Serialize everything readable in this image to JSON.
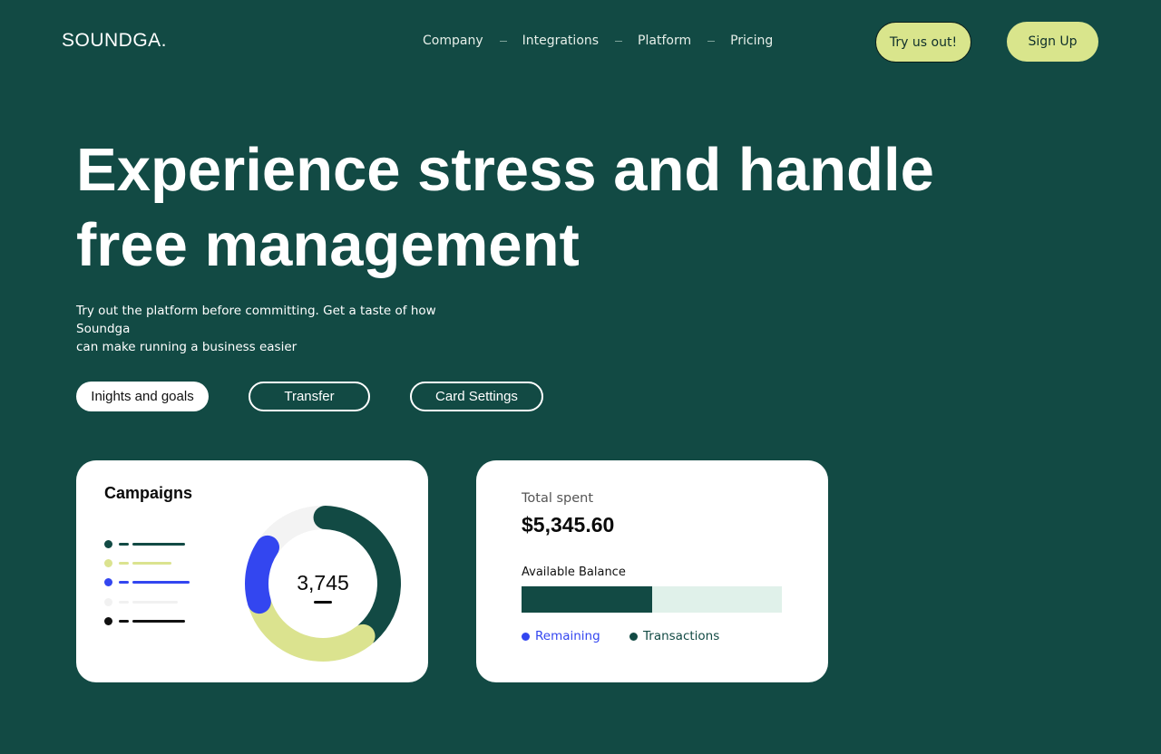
{
  "header": {
    "logo": "SOUNDGA.",
    "nav": [
      "Company",
      "Integrations",
      "Platform",
      "Pricing"
    ],
    "try_label": "Try us out!",
    "signup_label": "Sign Up"
  },
  "hero": {
    "title_line1": "Experience stress and handle",
    "title_line2": "free management",
    "subtitle_line1": "Try out the platform before committing. Get a taste of how Soundga",
    "subtitle_line2": "can make running a business easier"
  },
  "tabs": [
    "Inights and goals",
    "Transfer",
    "Card Settings"
  ],
  "campaigns": {
    "title": "Campaigns",
    "total": "3,745",
    "legend_colors": [
      "#124a44",
      "#dbe38f",
      "#3346f0",
      "#f1f1f1",
      "#111111"
    ],
    "donut_segments": [
      {
        "color": "#124a44",
        "fraction": 0.39
      },
      {
        "color": "#dbe38f",
        "fraction": 0.31
      },
      {
        "color": "#3346f0",
        "fraction": 0.15
      },
      {
        "color": "#f3f3f3",
        "fraction": 0.15
      }
    ]
  },
  "spending": {
    "total_label": "Total spent",
    "total_value": "$5,345.60",
    "balance_label": "Available Balance",
    "balance_fill_fraction": 0.5,
    "legend_remaining": "Remaining",
    "legend_transactions": "Transactions",
    "colors": {
      "remaining": "#3346f0",
      "transactions": "#124a44",
      "track": "#e0f1ea"
    }
  }
}
